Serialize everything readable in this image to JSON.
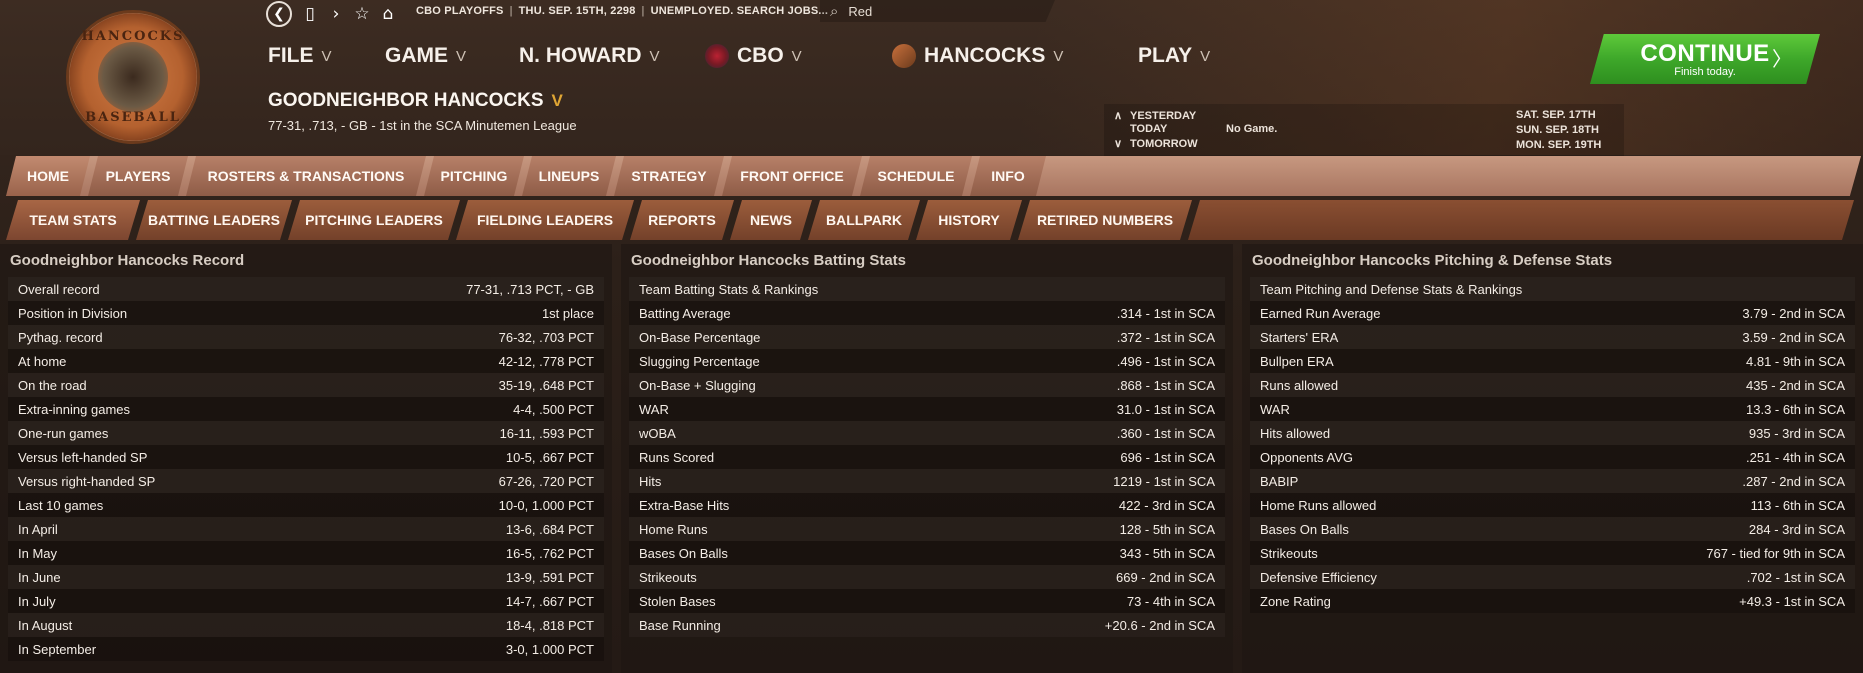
{
  "header": {
    "status": {
      "league": "CBO PLAYOFFS",
      "date": "THU. SEP. 15TH, 2298",
      "job": "UNEMPLOYED. SEARCH JOBS..."
    },
    "search": {
      "value": "Red"
    },
    "menu": [
      {
        "label": "FILE",
        "icon": ""
      },
      {
        "label": "GAME",
        "icon": ""
      },
      {
        "label": "N. HOWARD",
        "icon": ""
      },
      {
        "label": "CBO",
        "icon": "cbo-logo"
      },
      {
        "label": "HANCOCKS",
        "icon": "hancocks-logo"
      },
      {
        "label": "PLAY",
        "icon": ""
      }
    ],
    "team_name": "GOODNEIGHBOR HANCOCKS",
    "team_sub": "77-31, .713, - GB - 1st in the SCA Minutemen League",
    "schedule": {
      "yesterday": "YESTERDAY",
      "today": "TODAY",
      "tomorrow": "TOMORROW",
      "today_game": "No Game.",
      "dates": [
        "SAT. SEP. 17TH",
        "SUN. SEP. 18TH",
        "MON. SEP. 19TH"
      ]
    },
    "continue": {
      "title": "CONTINUE",
      "sub": "Finish today."
    },
    "logo": {
      "top": "HANCOCKS",
      "bottom": "BASEBALL"
    }
  },
  "tabs_primary": [
    "HOME",
    "PLAYERS",
    "ROSTERS & TRANSACTIONS",
    "PITCHING",
    "LINEUPS",
    "STRATEGY",
    "FRONT OFFICE",
    "SCHEDULE",
    "INFO"
  ],
  "tabs_secondary": [
    "TEAM STATS",
    "BATTING LEADERS",
    "PITCHING LEADERS",
    "FIELDING LEADERS",
    "REPORTS",
    "NEWS",
    "BALLPARK",
    "HISTORY",
    "RETIRED NUMBERS"
  ],
  "panels": {
    "record": {
      "title": "Goodneighbor Hancocks Record",
      "rows": [
        [
          "Overall record",
          "77-31, .713 PCT, - GB"
        ],
        [
          "Position in Division",
          "1st place"
        ],
        [
          "Pythag. record",
          "76-32, .703 PCT"
        ],
        [
          "At home",
          "42-12, .778 PCT"
        ],
        [
          "On the road",
          "35-19, .648 PCT"
        ],
        [
          "Extra-inning games",
          "4-4, .500 PCT"
        ],
        [
          "One-run games",
          "16-11, .593 PCT"
        ],
        [
          "Versus left-handed SP",
          "10-5, .667 PCT"
        ],
        [
          "Versus right-handed SP",
          "67-26, .720 PCT"
        ],
        [
          "Last 10 games",
          "10-0, 1.000 PCT"
        ],
        [
          "In April",
          "13-6, .684 PCT"
        ],
        [
          "In May",
          "16-5, .762 PCT"
        ],
        [
          "In June",
          "13-9, .591 PCT"
        ],
        [
          "In July",
          "14-7, .667 PCT"
        ],
        [
          "In August",
          "18-4, .818 PCT"
        ],
        [
          "In September",
          "3-0, 1.000 PCT"
        ]
      ]
    },
    "batting": {
      "title": "Goodneighbor Hancocks Batting Stats",
      "rows": [
        [
          "Team Batting Stats & Rankings",
          ""
        ],
        [
          "Batting Average",
          ".314 - 1st  in SCA"
        ],
        [
          "On-Base Percentage",
          ".372 - 1st  in SCA"
        ],
        [
          "Slugging Percentage",
          ".496 - 1st  in SCA"
        ],
        [
          "On-Base + Slugging",
          ".868 - 1st  in SCA"
        ],
        [
          "WAR",
          "31.0 - 1st  in SCA"
        ],
        [
          "wOBA",
          ".360 - 1st  in SCA"
        ],
        [
          "Runs Scored",
          "696 - 1st  in SCA"
        ],
        [
          "Hits",
          "1219 - 1st  in SCA"
        ],
        [
          "Extra-Base Hits",
          "422 - 3rd  in SCA"
        ],
        [
          "Home Runs",
          "128 - 5th  in SCA"
        ],
        [
          "Bases On Balls",
          "343 - 5th  in SCA"
        ],
        [
          "Strikeouts",
          "669 - 2nd  in SCA"
        ],
        [
          "Stolen Bases",
          "73 - 4th  in SCA"
        ],
        [
          "Base Running",
          "+20.6 - 2nd  in SCA"
        ]
      ]
    },
    "pitching": {
      "title": "Goodneighbor Hancocks Pitching & Defense Stats",
      "rows": [
        [
          "Team Pitching and Defense Stats & Rankings",
          ""
        ],
        [
          "Earned Run Average",
          "3.79 - 2nd  in SCA"
        ],
        [
          "Starters' ERA",
          "3.59 - 2nd  in SCA"
        ],
        [
          "Bullpen ERA",
          "4.81 - 9th  in SCA"
        ],
        [
          "Runs allowed",
          "435 - 2nd  in SCA"
        ],
        [
          "WAR",
          "13.3 - 6th  in SCA"
        ],
        [
          "Hits allowed",
          "935 - 3rd  in SCA"
        ],
        [
          "Opponents AVG",
          ".251 - 4th  in SCA"
        ],
        [
          "BABIP",
          ".287 - 2nd  in SCA"
        ],
        [
          "Home Runs allowed",
          "113 - 6th  in SCA"
        ],
        [
          "Bases On Balls",
          "284 - 3rd  in SCA"
        ],
        [
          "Strikeouts",
          "767 -  tied for 9th  in SCA"
        ],
        [
          "Defensive Efficiency",
          ".702 - 1st  in SCA"
        ],
        [
          "Zone Rating",
          "+49.3 - 1st  in SCA"
        ]
      ]
    }
  }
}
